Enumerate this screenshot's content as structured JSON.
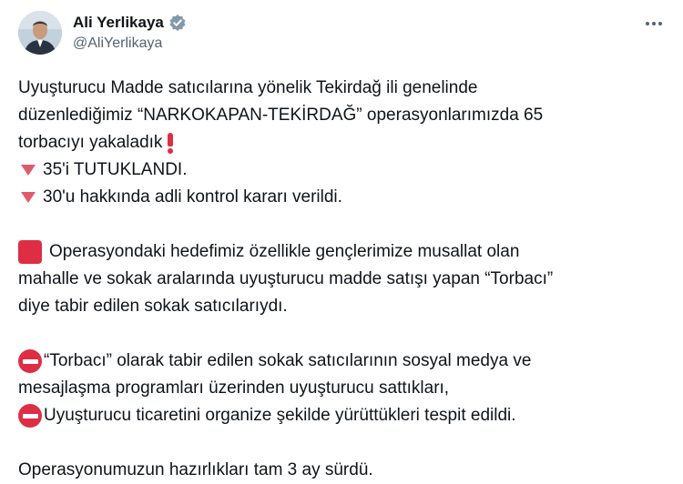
{
  "author": {
    "display_name": "Ali Yerlikaya",
    "handle": "@AliYerlikaya"
  },
  "icons": {
    "avatar": "profile-photo",
    "verified": "verified-badge-icon",
    "more": "more-options-icon",
    "bullet": "red-triangle-down",
    "square": "red-square",
    "no_entry": "no-entry-icon",
    "exclamation": "red-exclamation"
  },
  "colors": {
    "verified": "#829aab",
    "emoji_red": "#dd2e44",
    "text": "#0f1419",
    "secondary": "#536471"
  },
  "post": {
    "p1_line1": "Uyuşturucu Madde satıcılarına yönelik Tekirdağ ili genelinde",
    "p1_line2": "düzenlediğimiz “NARKOKAPAN-TEKİRDAĞ” operasyonlarımızda 65",
    "p1_line3": "torbacıyı yakaladık",
    "bullet1": "35'i TUTUKLANDI.",
    "bullet2": "30'u hakkında adli kontrol kararı verildi.",
    "p2_line1": "Operasyondaki hedefimiz özellikle gençlerimize musallat olan",
    "p2_line2": "mahalle ve sokak aralarında uyuşturucu madde satışı yapan “Torbacı”",
    "p2_line3": "diye tabir edilen sokak satıcılarıydı.",
    "p3_line1": "“Torbacı” olarak tabir edilen sokak satıcılarının sosyal medya ve",
    "p3_line2": "mesajlaşma programları üzerinden uyuşturucu sattıkları,",
    "p3_line3": "Uyuşturucu ticaretini organize şekilde yürüttükleri tespit edildi.",
    "p4_line1": "Operasyonumuzun hazırlıkları tam 3 ay sürdü."
  }
}
